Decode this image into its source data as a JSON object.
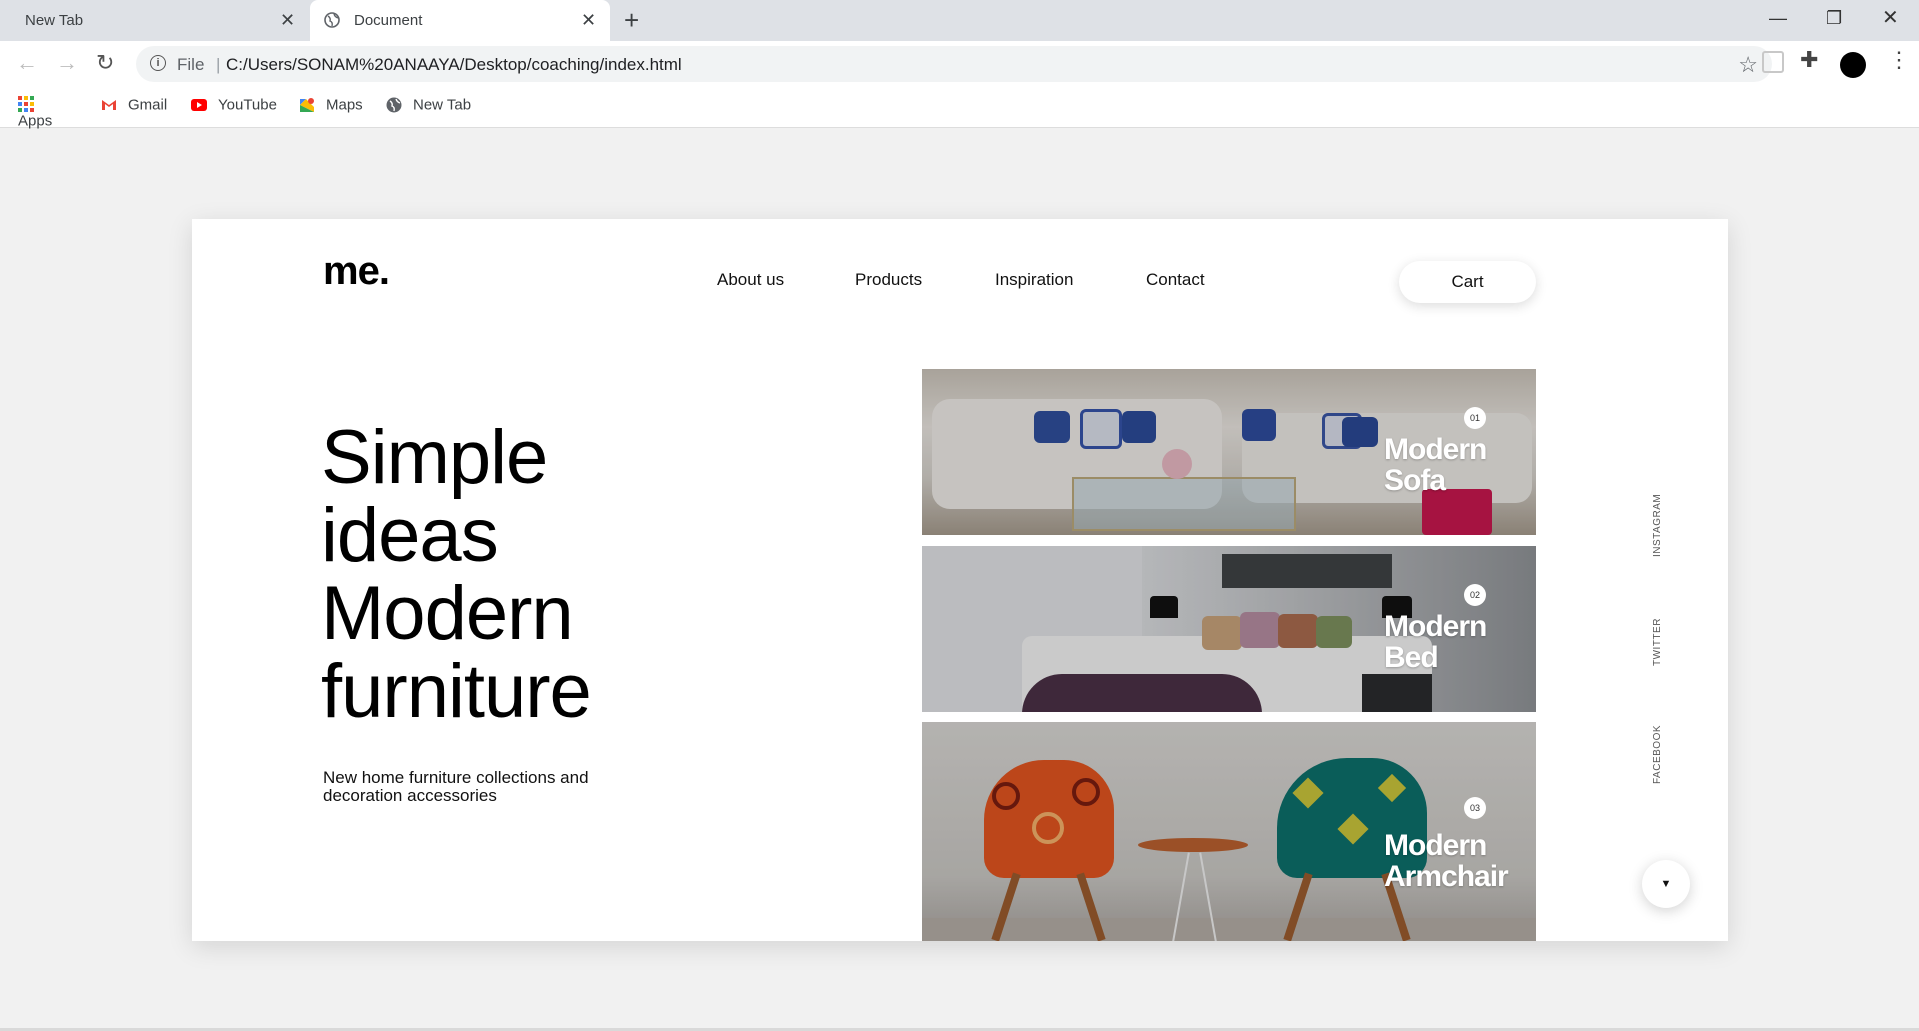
{
  "browser": {
    "tabs": [
      {
        "title": "New Tab",
        "active": false
      },
      {
        "title": "Document",
        "active": true
      }
    ],
    "new_tab_symbol": "+",
    "close_symbol": "✕",
    "window_controls": {
      "minimize": "—",
      "maximize": "❐",
      "close": "✕"
    },
    "nav": {
      "back": "←",
      "forward": "→",
      "reload": "↻"
    },
    "omnibox": {
      "info_icon": "i",
      "scheme_label": "File",
      "separator": "|",
      "url": "C:/Users/SONAM%20ANAAYA/Desktop/coaching/index.html",
      "star": "☆"
    },
    "toolbar_icons": {
      "extension": "puzzle-icon",
      "puzzle_glyph": "✚",
      "menu_glyph": "⋮"
    },
    "bookmarks": [
      {
        "label": "Apps",
        "icon": "apps-grid-icon"
      },
      {
        "label": "Gmail",
        "icon": "gmail-icon"
      },
      {
        "label": "YouTube",
        "icon": "youtube-icon"
      },
      {
        "label": "Maps",
        "icon": "maps-icon"
      },
      {
        "label": "New Tab",
        "icon": "globe-icon"
      }
    ]
  },
  "site": {
    "logo": "me.",
    "nav": [
      "About us",
      "Products",
      "Inspiration",
      "Contact"
    ],
    "cart_label": "Cart",
    "hero": {
      "lines": [
        "Simple",
        "ideas",
        "Modern",
        "furniture"
      ],
      "subtitle": "New home furniture collections and decoration accessories"
    },
    "products": [
      {
        "number": "01",
        "line1": "Modern",
        "line2": "Sofa"
      },
      {
        "number": "02",
        "line1": "Modern",
        "line2": "Bed"
      },
      {
        "number": "03",
        "line1": "Modern",
        "line2": "Armchair"
      }
    ],
    "social": [
      "INSTAGRAM",
      "TWITTER",
      "FACEBOOK"
    ],
    "scroll_down_symbol": "▼"
  },
  "colors": {
    "page_background": "#f1f1f1",
    "card_background": "#ffffff",
    "text": "#111111",
    "tabstrip": "#dee1e6"
  }
}
